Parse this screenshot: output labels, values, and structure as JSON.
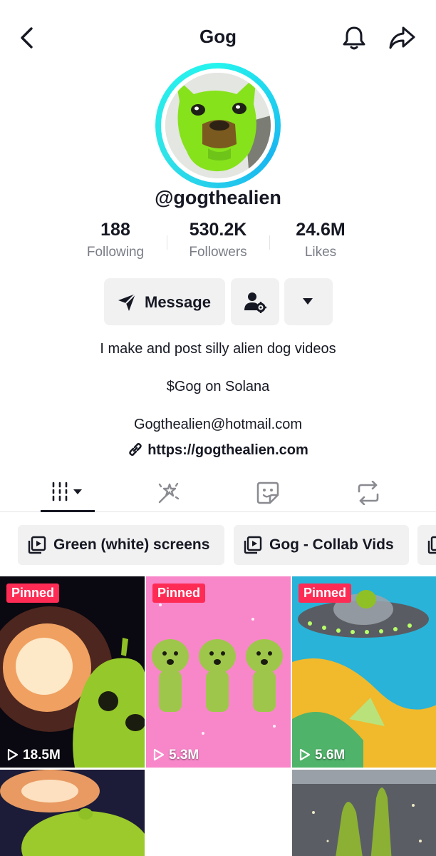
{
  "header": {
    "title": "Gog"
  },
  "profile": {
    "username": "@gogthealien",
    "stats": [
      {
        "value": "188",
        "label": "Following"
      },
      {
        "value": "530.2K",
        "label": "Followers"
      },
      {
        "value": "24.6M",
        "label": "Likes"
      }
    ],
    "message_label": "Message",
    "bio": [
      "I make and post silly alien dog videos",
      "$Gog on Solana",
      "Gogthealien@hotmail.com"
    ],
    "link": "https://gogthealien.com"
  },
  "tabs": [
    {
      "icon": "videos-grid-icon",
      "active": true
    },
    {
      "icon": "magic-wand-icon",
      "active": false
    },
    {
      "icon": "sticker-icon",
      "active": false
    },
    {
      "icon": "repost-icon",
      "active": false
    }
  ],
  "playlists": [
    {
      "label": "Green (white) screens",
      "icon": "playlist-icon"
    },
    {
      "label": "Gog - Collab Vids",
      "icon": "playlist-icon"
    }
  ],
  "videos": [
    {
      "pinned_label": "Pinned",
      "views": "18.5M"
    },
    {
      "pinned_label": "Pinned",
      "views": "5.3M"
    },
    {
      "pinned_label": "Pinned",
      "views": "5.6M"
    },
    {
      "pinned_label": "",
      "views": ""
    },
    {
      "pinned_label": "",
      "views": ""
    },
    {
      "pinned_label": "",
      "views": ""
    }
  ],
  "colors": {
    "accent": "#fe2c55",
    "avatar_ring": "#25f4ee",
    "text_primary": "#161823",
    "text_secondary": "#7a7d86",
    "button_bg": "#f1f1f2"
  }
}
